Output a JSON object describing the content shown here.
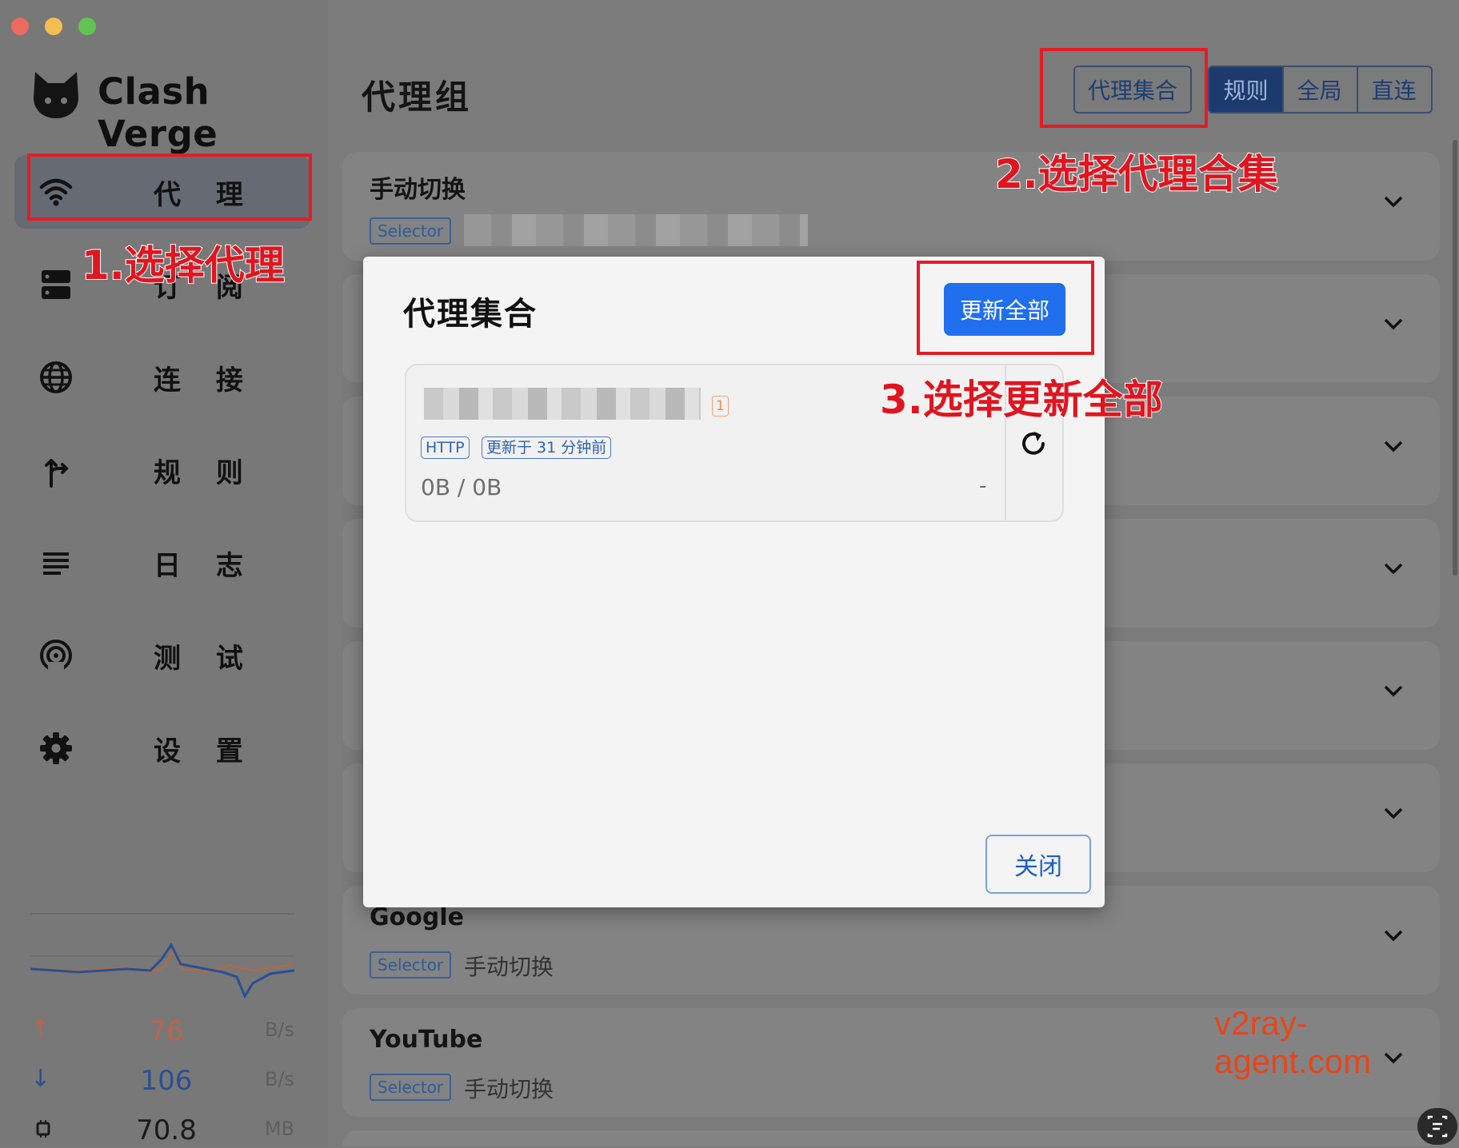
{
  "app": {
    "title": "Clash Verge"
  },
  "sidebar": {
    "items": [
      {
        "label": "代 理",
        "icon": "wifi-icon"
      },
      {
        "label": "订 阅",
        "icon": "server-icon"
      },
      {
        "label": "连 接",
        "icon": "globe-icon"
      },
      {
        "label": "规 则",
        "icon": "fork-icon"
      },
      {
        "label": "日 志",
        "icon": "list-icon"
      },
      {
        "label": "测 试",
        "icon": "radar-icon"
      },
      {
        "label": "设 置",
        "icon": "gear-icon"
      }
    ],
    "traffic": {
      "upload": {
        "value": "76",
        "unit": "B/s"
      },
      "download": {
        "value": "106",
        "unit": "B/s"
      },
      "memory": {
        "value": "70.8",
        "unit": "MB"
      }
    }
  },
  "header": {
    "title": "代理组",
    "provider_button": "代理集合",
    "modes": [
      "规则",
      "全局",
      "直连"
    ]
  },
  "groups": [
    {
      "name": "手动切换",
      "type": "Selector",
      "current": ""
    },
    {
      "name": "Google",
      "type": "Selector",
      "current": "手动切换"
    },
    {
      "name": "YouTube",
      "type": "Selector",
      "current": "手动切换"
    }
  ],
  "dialog": {
    "title": "代理集合",
    "update_all": "更新全部",
    "provider": {
      "count": "1",
      "type": "HTTP",
      "updated": "更新于 31 分钟前",
      "usage": "0B / 0B",
      "expire": "-"
    },
    "close": "关闭"
  },
  "annotations": {
    "step1": "1.选择代理",
    "step2": "2.选择代理合集",
    "step3": "3.选择更新全部",
    "watermark": "v2ray-agent.com"
  },
  "colors": {
    "accent": "#1f6fef",
    "annotation": "#e0151f",
    "active_mode": "#1c3d74"
  }
}
